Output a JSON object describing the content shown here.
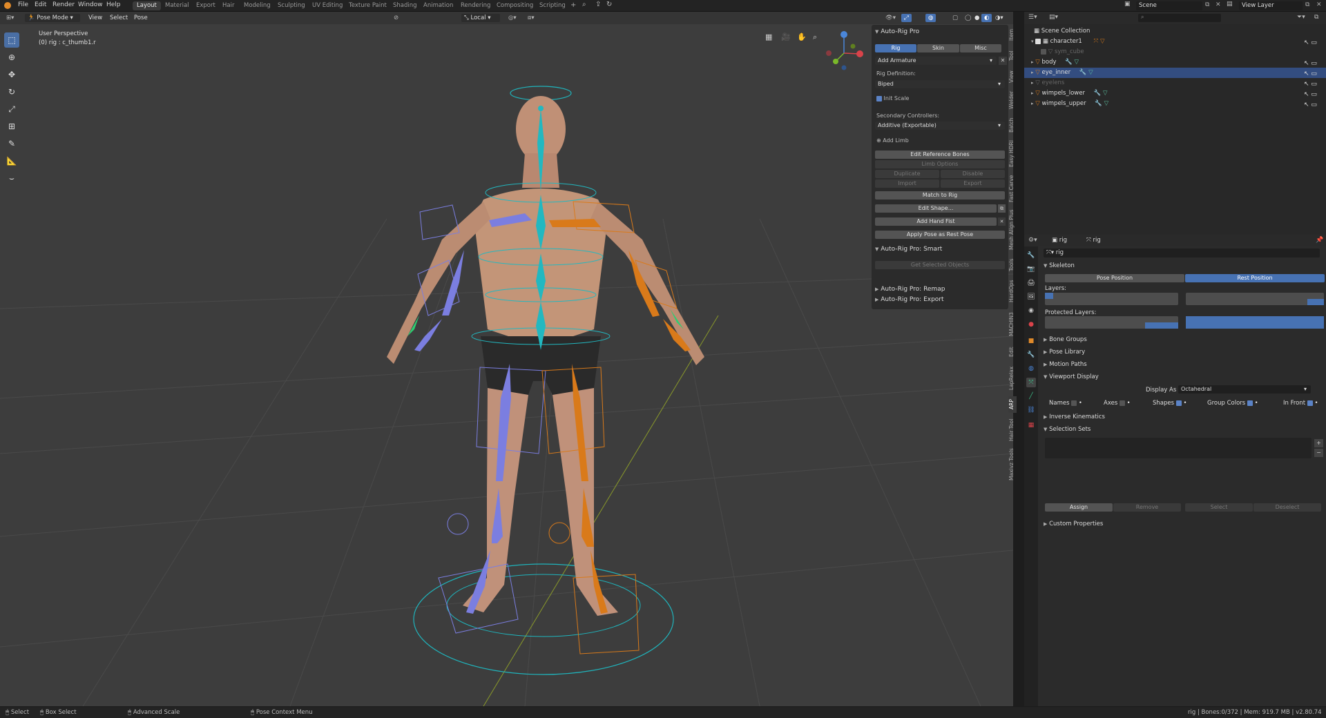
{
  "menu": [
    "File",
    "Edit",
    "Render",
    "Window",
    "Help"
  ],
  "workspaces": [
    "Layout",
    "Material",
    "Export",
    "Hair",
    "Modeling",
    "Sculpting",
    "UV Editing",
    "Texture Paint",
    "Shading",
    "Animation",
    "Rendering",
    "Compositing",
    "Scripting"
  ],
  "active_workspace": "Layout",
  "top_right": {
    "scene": "Scene",
    "view_layer": "View Layer"
  },
  "viewport": {
    "mode": "Pose Mode",
    "menus": [
      "View",
      "Select",
      "Pose"
    ],
    "orientation": "Local",
    "perspective": "User Perspective",
    "selection_info": "(0) rig : c_thumb1.r"
  },
  "npanel": {
    "title": "Auto-Rig Pro",
    "tabs": [
      "Rig",
      "Skin",
      "Misc"
    ],
    "add_armature": "Add Armature",
    "rig_definition_label": "Rig Definition:",
    "rig_definition_value": "Biped",
    "init_scale": "Init Scale",
    "secondary_label": "Secondary Controllers:",
    "secondary_value": "Additive (Exportable)",
    "add_limb": "Add Limb",
    "edit_ref_bones": "Edit Reference Bones",
    "limb_options": "Limb Options",
    "duplicate": "Duplicate",
    "disable": "Disable",
    "import": "Import",
    "export": "Export",
    "match_to_rig": "Match to Rig",
    "edit_shape": "Edit Shape...",
    "add_hand_fist": "Add Hand Fist",
    "apply_pose": "Apply Pose as Rest Pose",
    "smart_title": "Auto-Rig Pro: Smart",
    "get_selected": "Get Selected Objects",
    "remap_title": "Auto-Rig Pro: Remap",
    "export_title": "Auto-Rig Pro: Export"
  },
  "side_tabs": [
    "Item",
    "Tool",
    "View",
    "Welder",
    "Batch",
    "Easy HDRI",
    "Fast Carve",
    "Mesh Align Plus",
    "Tools",
    "HardOps",
    "MACHIN3",
    "Edit",
    "LapRelax",
    "ARP",
    "Hair Tool",
    "Maxivz Tools"
  ],
  "outliner": {
    "root": "Scene Collection",
    "items": [
      {
        "name": "character1",
        "dim": false,
        "sel": false
      },
      {
        "name": "sym_cube",
        "dim": true,
        "sel": false
      },
      {
        "name": "body",
        "dim": false,
        "sel": false
      },
      {
        "name": "eye_inner",
        "dim": false,
        "sel": true
      },
      {
        "name": "eyelens",
        "dim": true,
        "sel": false
      },
      {
        "name": "wimpels_lower",
        "dim": false,
        "sel": false
      },
      {
        "name": "wimpels_upper",
        "dim": false,
        "sel": false
      }
    ]
  },
  "properties": {
    "object": "rig",
    "data": "rig",
    "data_field": "rig",
    "skeleton": "Skeleton",
    "pose_position": "Pose Position",
    "rest_position": "Rest Position",
    "layers": "Layers:",
    "protected_layers": "Protected Layers:",
    "bone_groups": "Bone Groups",
    "pose_library": "Pose Library",
    "motion_paths": "Motion Paths",
    "viewport_display": "Viewport Display",
    "display_as_label": "Display As",
    "display_as_value": "Octahedral",
    "names": "Names",
    "axes": "Axes",
    "shapes": "Shapes",
    "group_colors": "Group Colors",
    "in_front": "In Front",
    "ik": "Inverse Kinematics",
    "selection_sets": "Selection Sets",
    "assign": "Assign",
    "remove": "Remove",
    "select": "Select",
    "deselect": "Deselect",
    "custom_props": "Custom Properties"
  },
  "status": {
    "select": "Select",
    "box_select": "Box Select",
    "advanced_scale": "Advanced Scale",
    "pose_context": "Pose Context Menu",
    "info": "rig | Bones:0/372 | Mem: 919.7 MB | v2.80.74"
  },
  "colors": {
    "accent": "#4772b3",
    "left_bones": "#7b7ee0",
    "right_bones": "#d97a1a",
    "center_bones": "#22b8c0"
  }
}
